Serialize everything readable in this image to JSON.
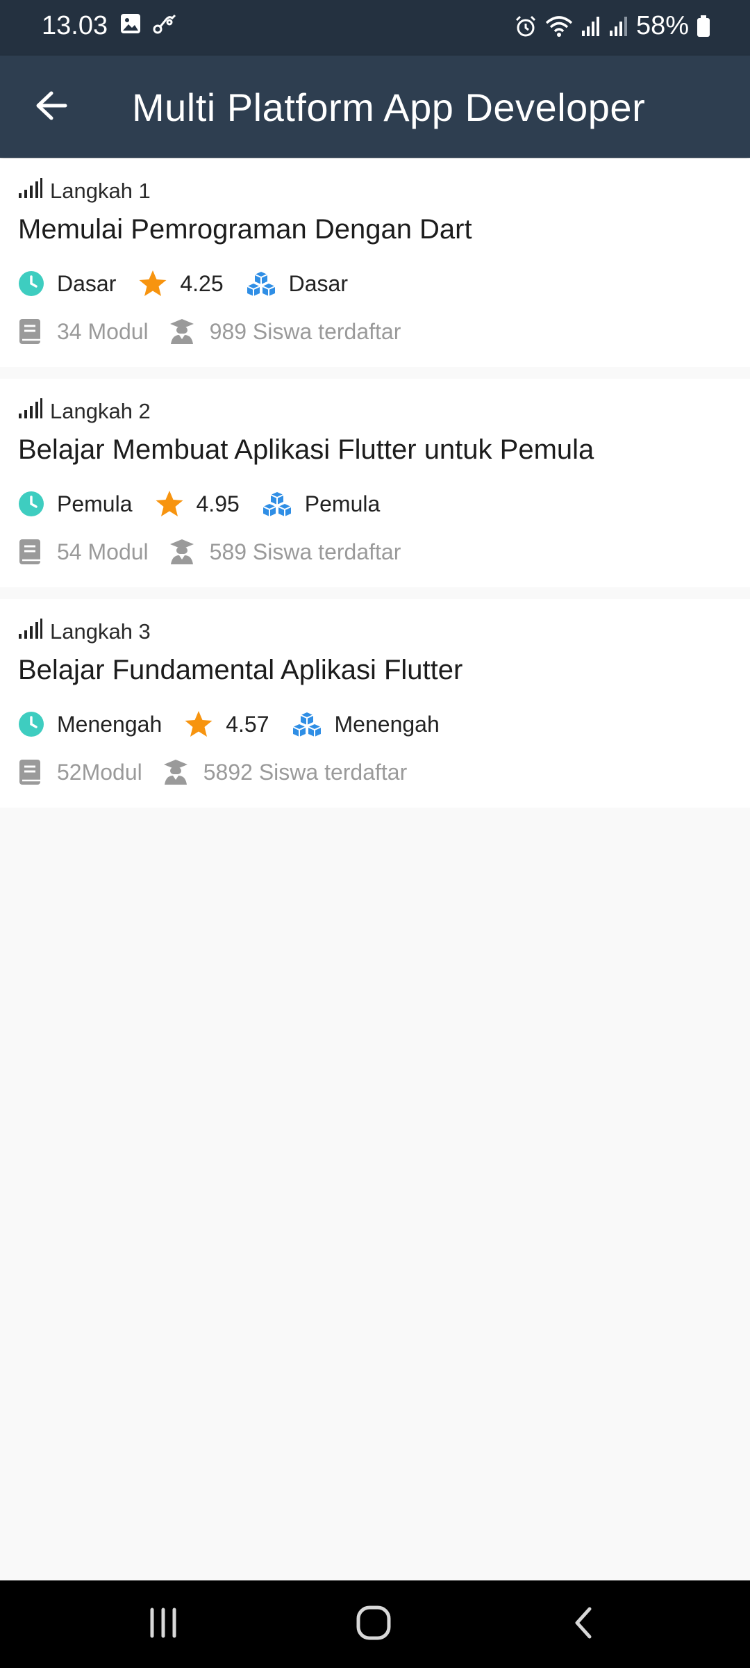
{
  "status_bar": {
    "time": "13.03",
    "battery": "58%",
    "icons": [
      "image-icon",
      "link-icon",
      "alarm-icon",
      "wifi-icon",
      "signal-icon",
      "signal-icon",
      "battery-icon"
    ]
  },
  "app_bar": {
    "title": "Multi Platform App Developer",
    "back_icon": "arrow-left-icon"
  },
  "colors": {
    "status_bar_bg": "#243140",
    "app_bar_bg": "#2e3e50",
    "clock_teal": "#3ecdc0",
    "star_orange": "#f7940f",
    "cube_blue": "#2f8ee5",
    "muted_gray": "#9a9a9a",
    "background": "#f9f9f9"
  },
  "courses": [
    {
      "step": "Langkah 1",
      "title": "Memulai Pemrograman Dengan Dart",
      "time_level": "Dasar",
      "rating": "4.25",
      "difficulty": "Dasar",
      "modules": "34 Modul",
      "students": "989 Siswa terdaftar"
    },
    {
      "step": "Langkah 2",
      "title": "Belajar Membuat Aplikasi Flutter untuk Pemula",
      "time_level": "Pemula",
      "rating": "4.95",
      "difficulty": "Pemula",
      "modules": "54 Modul",
      "students": "589 Siswa terdaftar"
    },
    {
      "step": "Langkah 3",
      "title": "Belajar Fundamental Aplikasi Flutter",
      "time_level": "Menengah",
      "rating": "4.57",
      "difficulty": "Menengah",
      "modules": "52Modul",
      "students": "5892 Siswa terdaftar"
    }
  ],
  "nav_bar": {
    "icons": [
      "recent-apps-icon",
      "home-icon",
      "back-icon"
    ]
  }
}
